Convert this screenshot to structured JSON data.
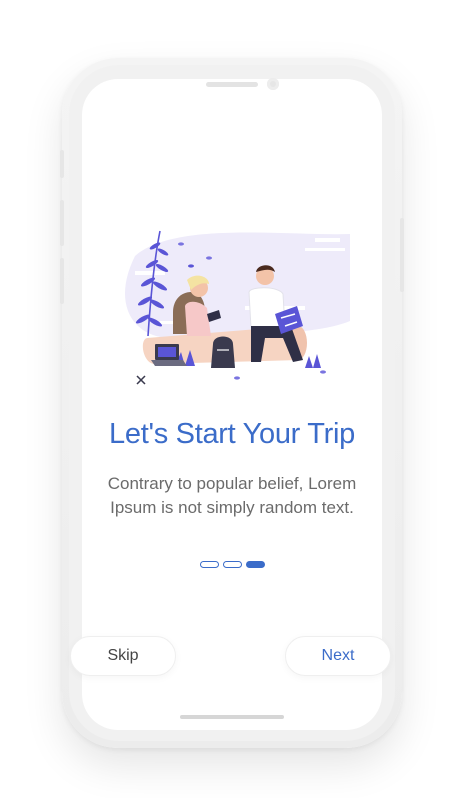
{
  "onboarding": {
    "title": "Let's Start Your Trip",
    "description": "Contrary to popular belief, Lorem Ipsum is not simply random text.",
    "pagination": {
      "total": 3,
      "current": 3
    },
    "skip_label": "Skip",
    "next_label": "Next"
  },
  "colors": {
    "accent": "#3b6cc9",
    "illustration_bg": "#eeebfa",
    "plant": "#5a55d6",
    "log": "#f6d4c2"
  }
}
